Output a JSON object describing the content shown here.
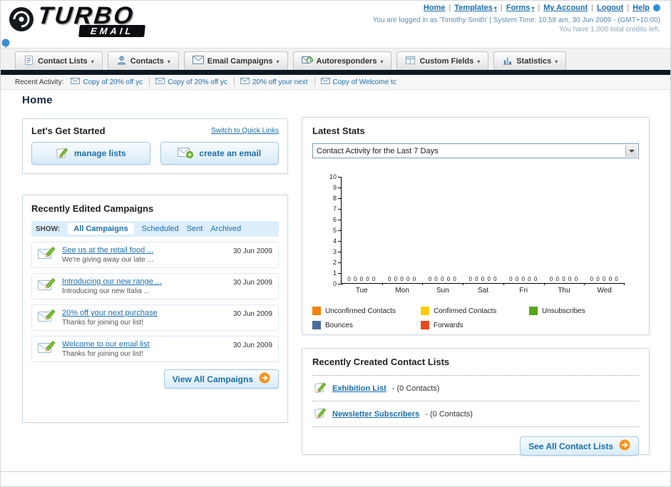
{
  "header": {
    "logo_primary": "TURBO",
    "logo_secondary": "EMAIL",
    "nav_links": [
      {
        "label": "Home"
      },
      {
        "label": "Templates"
      },
      {
        "label": "Forms"
      },
      {
        "label": "My Account"
      },
      {
        "label": "Logout"
      },
      {
        "label": "Help"
      }
    ],
    "login_info": "You are logged in as 'Timothy Smith' | System Time: 10:58 am, 30 Jun 2009 - (GMT+10:00)",
    "credits_info": "You have 1,000 total credits left."
  },
  "nav": {
    "tabs": [
      {
        "label": "Contact Lists"
      },
      {
        "label": "Contacts"
      },
      {
        "label": "Email Campaigns"
      },
      {
        "label": "Autoresponders"
      },
      {
        "label": "Custom Fields"
      },
      {
        "label": "Statistics"
      }
    ]
  },
  "recent_activity": {
    "label": "Recent Activity:",
    "items": [
      {
        "label": "Copy of 20% off yc"
      },
      {
        "label": "Copy of 20% off yc"
      },
      {
        "label": "20% off your next"
      },
      {
        "label": "Copy of Welcome tc"
      }
    ]
  },
  "page": {
    "title": "Home"
  },
  "get_started": {
    "title": "Let's Get Started",
    "switch_link": "Switch to Quick Links",
    "manage_lists_label": "manage lists",
    "create_email_label": "create an email"
  },
  "campaigns": {
    "title": "Recently Edited Campaigns",
    "show_label": "SHOW:",
    "tabs": [
      {
        "label": "All Campaigns"
      },
      {
        "label": "Scheduled"
      },
      {
        "label": "Sent"
      },
      {
        "label": "Archived"
      }
    ],
    "items": [
      {
        "title": "See us at the retail food ...",
        "subtitle": "We're giving away our late ...",
        "date": "30 Jun 2009"
      },
      {
        "title": "Introducing our new range ...",
        "subtitle": "Introducing our new Italia ...",
        "date": "30 Jun 2009"
      },
      {
        "title": "20% off your next purchase",
        "subtitle": "Thanks for joining our list!",
        "date": "30 Jun 2009"
      },
      {
        "title": "Welcome to our email list",
        "subtitle": "Thanks for joining our list!",
        "date": "30 Jun 2009"
      }
    ],
    "view_all_label": "View All Campaigns"
  },
  "stats": {
    "title": "Latest Stats",
    "period_selected": "Contact Activity for the Last 7 Days"
  },
  "chart_data": {
    "type": "bar",
    "title": "Contact Activity for the Last 7 Days",
    "categories": [
      "Tue",
      "Mon",
      "Sun",
      "Sat",
      "Fri",
      "Thu",
      "Wed"
    ],
    "series": [
      {
        "name": "Unconfirmed Contacts",
        "color": "#f5820b",
        "values": [
          0,
          0,
          0,
          0,
          0,
          0,
          0
        ]
      },
      {
        "name": "Confirmed Contacts",
        "color": "#ffcc00",
        "values": [
          0,
          0,
          0,
          0,
          0,
          0,
          0
        ]
      },
      {
        "name": "Unsubscribes",
        "color": "#5aa51e",
        "values": [
          0,
          0,
          0,
          0,
          0,
          0,
          0
        ]
      },
      {
        "name": "Bounces",
        "color": "#4a6e9e",
        "values": [
          0,
          0,
          0,
          0,
          0,
          0,
          0
        ]
      },
      {
        "name": "Forwards",
        "color": "#e8491d",
        "values": [
          0,
          0,
          0,
          0,
          0,
          0,
          0
        ]
      }
    ],
    "xlabel": "",
    "ylabel": "",
    "ylim": [
      0,
      10
    ],
    "ytick_step": 1,
    "grid": false,
    "legend_position": "bottom"
  },
  "contact_lists": {
    "title": "Recently Created Contact Lists",
    "items": [
      {
        "name": "Exhibition List",
        "detail": "- (0 Contacts)"
      },
      {
        "name": "Newsletter Subscribers",
        "detail": "- (0 Contacts)"
      }
    ],
    "see_all_label": "See All Contact Lists"
  }
}
